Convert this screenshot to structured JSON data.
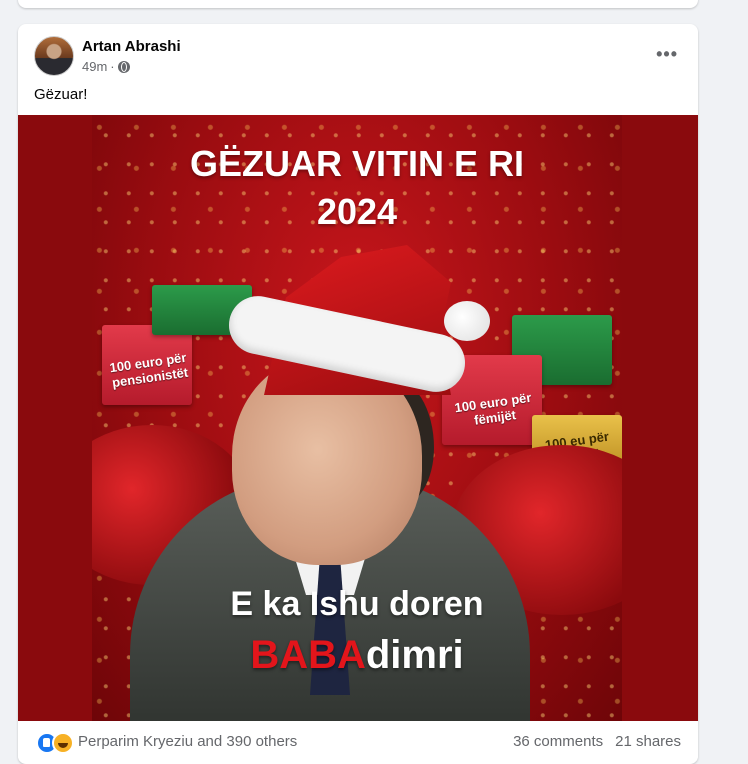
{
  "post": {
    "author": "Artan Abrashi",
    "time": "49m",
    "separator": "·",
    "privacy_icon": "globe-icon",
    "more_icon": "more-options-icon",
    "more_label": "•••",
    "text": "Gëzuar!"
  },
  "image": {
    "headline_line1": "GËZUAR VITIN E RI",
    "headline_line2": "2024",
    "gift1": "100 euro për pensionistët",
    "gift2": "100 euro për fëmijët",
    "gift3": "100 eu për fëmijët",
    "caption_line1": "E ka Ishu doren",
    "caption_red": "BABA",
    "caption_rest": "dimri"
  },
  "reactions": {
    "icons": [
      "like-icon",
      "haha-icon"
    ],
    "names": "Perparim Kryeziu and 390 others",
    "comments": "36 comments",
    "shares": "21 shares"
  },
  "colors": {
    "facebook_blue": "#1877f2",
    "image_bg": "#8a0a0d",
    "accent_red": "#e3151b"
  }
}
